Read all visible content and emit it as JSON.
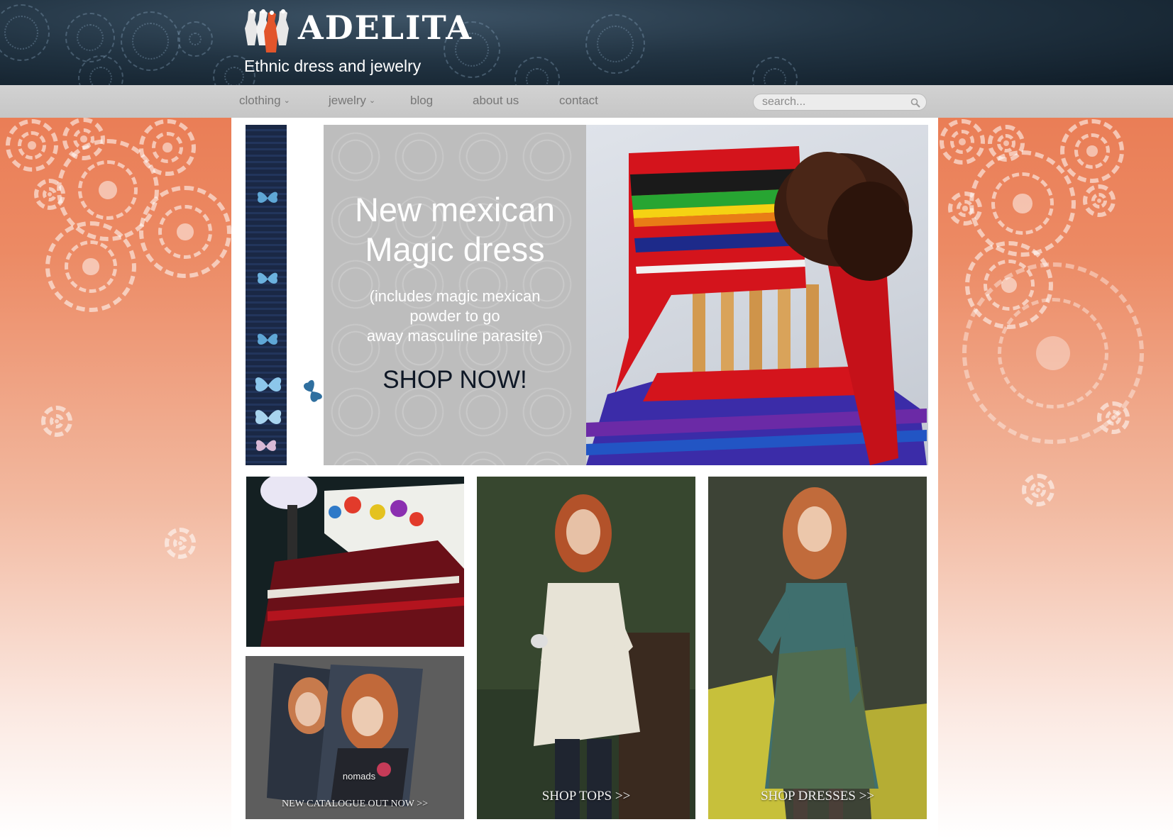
{
  "brand": {
    "name": "ADELITA",
    "tagline": "Ethnic dress and jewelry"
  },
  "nav": {
    "items": [
      {
        "label": "clothing",
        "has_dropdown": true
      },
      {
        "label": "jewelry",
        "has_dropdown": true
      },
      {
        "label": "blog",
        "has_dropdown": false
      },
      {
        "label": "about us",
        "has_dropdown": false
      },
      {
        "label": "contact",
        "has_dropdown": false
      }
    ],
    "search_placeholder": "search..."
  },
  "hero": {
    "title_line1": "New mexican",
    "title_line2": "Magic dress",
    "sub_line1": "(includes magic mexican",
    "sub_line2": "powder to go",
    "sub_line3": "away masculine parasite)",
    "cta": "SHOP NOW!"
  },
  "tiles": {
    "catalogue_label": "NEW CATALOGUE OUT NOW >>",
    "tops_label": "SHOP TOPS >>",
    "dresses_label": "SHOP DRESSES >>",
    "catalogue_cover_text": "nomads"
  },
  "colors": {
    "header_bg": "#1a2a38",
    "nav_bg": "#c9c9c9",
    "accent_orange": "#e8734a",
    "hero_panel": "#bdbdbd",
    "cta_text": "#0f1826"
  },
  "icons": {
    "search": "magnifier-icon",
    "dropdown": "chevron-down-icon"
  }
}
